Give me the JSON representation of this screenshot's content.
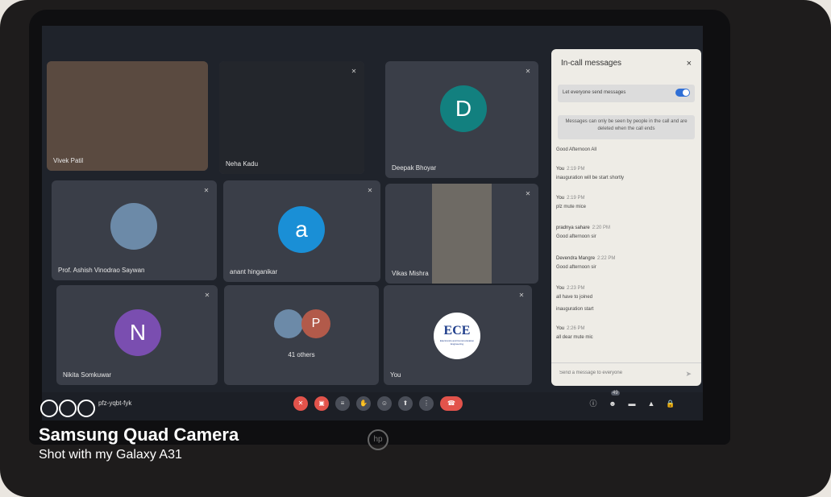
{
  "tiles": [
    {
      "name": "Vivek Patil"
    },
    {
      "name": "Neha Kadu"
    },
    {
      "name": "Deepak Bhoyar",
      "avatar": "D"
    },
    {
      "name": "Prof. Ashish Vinodrao Saywan"
    },
    {
      "name": "anant hinganikar",
      "avatar": "a"
    },
    {
      "name": "Vikas Mishra"
    },
    {
      "name": "Nikita Somkuwar",
      "avatar": "N"
    },
    {
      "others_avatar": "P",
      "others_label": "41 others"
    },
    {
      "name": "You",
      "logo_text": "ECE",
      "logo_sub": "Electronics and Communication Engineering"
    }
  ],
  "panel": {
    "title": "In-call messages",
    "close": "×",
    "toggle_label": "Let everyone send messages",
    "notice": "Messages can only be seen by people in the call and are deleted when the call ends",
    "messages": [
      {
        "sender": "",
        "time": "",
        "text": "Good Afternoon All"
      },
      {
        "sender": "You",
        "time": "2:19 PM",
        "text": "inauguration will be start shortly"
      },
      {
        "sender": "You",
        "time": "2:19 PM",
        "text": "plz mute mice"
      },
      {
        "sender": "pradnya sahare",
        "time": "2:20 PM",
        "text": "Good afternoon sir"
      },
      {
        "sender": "Devendra Mangre",
        "time": "2:22 PM",
        "text": "Good afternoon sir"
      },
      {
        "sender": "You",
        "time": "2:23 PM",
        "text": "all have to joined"
      },
      {
        "sender": "",
        "time": "",
        "text": "inauguration start"
      },
      {
        "sender": "You",
        "time": "2:26 PM",
        "text": "all dear mute mic"
      }
    ],
    "input_placeholder": "Send a message to everyone"
  },
  "bar": {
    "meeting_code": "pfz-yqbt-fyk",
    "participants_count": "49"
  },
  "camera": {
    "line1": "Samsung Quad Camera",
    "line2": "Shot with my Galaxy A31"
  },
  "colors": {
    "deepak": "#12807f",
    "anant": "#1a8fd6",
    "nikita": "#7a4eb0",
    "p_avatar": "#b25a4a",
    "end_call": "#e2534b"
  }
}
